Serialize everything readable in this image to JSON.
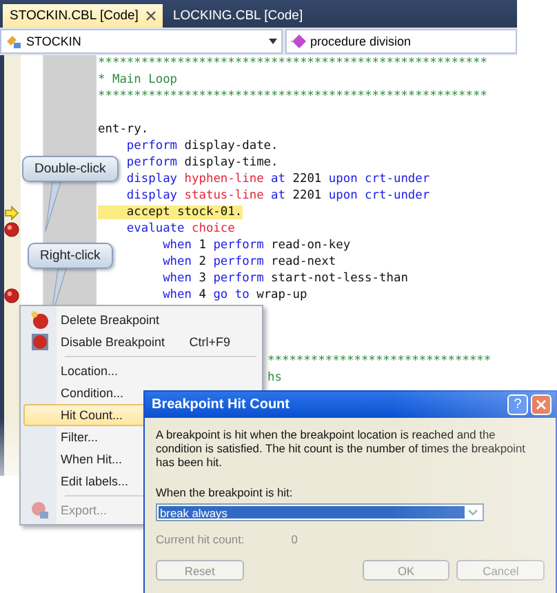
{
  "tabs": [
    {
      "label": "STOCKIN.CBL [Code]",
      "selected": true
    },
    {
      "label": "LOCKING.CBL [Code]",
      "selected": false
    }
  ],
  "nav": {
    "type_combo": "STOCKIN",
    "member_combo": "procedure division"
  },
  "code_lines": [
    {
      "tokens": [
        {
          "text": "******************************************************",
          "kind": "comment"
        }
      ],
      "current": false,
      "breakpoint": false
    },
    {
      "tokens": [
        {
          "text": "* Main Loop",
          "kind": "comment"
        }
      ],
      "current": false,
      "breakpoint": false
    },
    {
      "tokens": [
        {
          "text": "******************************************************",
          "kind": "comment"
        }
      ],
      "current": false,
      "breakpoint": false
    },
    {
      "current": false,
      "breakpoint": false
    },
    {
      "tokens": [
        {
          "text": "ent-ry.",
          "kind": "plain"
        }
      ],
      "current": false,
      "breakpoint": false
    },
    {
      "tokens": [
        {
          "text": "    perform",
          "kind": "keyword"
        },
        {
          "text": " display-date.",
          "kind": "plain"
        }
      ],
      "current": false,
      "breakpoint": false
    },
    {
      "tokens": [
        {
          "text": "    perform",
          "kind": "keyword"
        },
        {
          "text": " display-time.",
          "kind": "plain"
        }
      ],
      "current": false,
      "breakpoint": false
    },
    {
      "tokens": [
        {
          "text": "    display",
          "kind": "keyword"
        },
        {
          "text": " hyphen-line",
          "kind": "variable"
        },
        {
          "text": " at",
          "kind": "keyword"
        },
        {
          "text": " 2201",
          "kind": "plain"
        },
        {
          "text": " upon crt-under",
          "kind": "keyword"
        }
      ],
      "current": false,
      "breakpoint": false
    },
    {
      "tokens": [
        {
          "text": "    display",
          "kind": "keyword"
        },
        {
          "text": " status-line",
          "kind": "variable"
        },
        {
          "text": " at",
          "kind": "keyword"
        },
        {
          "text": " 2201",
          "kind": "plain"
        },
        {
          "text": " upon crt-under",
          "kind": "keyword"
        }
      ],
      "current": false,
      "breakpoint": false
    },
    {
      "tokens": [
        {
          "text": "    accept stock-01.",
          "kind": "plain"
        }
      ],
      "current": true,
      "breakpoint": false
    },
    {
      "tokens": [
        {
          "text": "    evaluate",
          "kind": "keyword"
        },
        {
          "text": " choice",
          "kind": "variable"
        }
      ],
      "current": false,
      "breakpoint": true
    },
    {
      "tokens": [
        {
          "text": "         when",
          "kind": "keyword"
        },
        {
          "text": " 1",
          "kind": "plain"
        },
        {
          "text": " perform",
          "kind": "keyword"
        },
        {
          "text": " read-on-key",
          "kind": "plain"
        }
      ],
      "current": false,
      "breakpoint": false
    },
    {
      "tokens": [
        {
          "text": "         when",
          "kind": "keyword"
        },
        {
          "text": " 2",
          "kind": "plain"
        },
        {
          "text": " perform",
          "kind": "keyword"
        },
        {
          "text": " read-next",
          "kind": "plain"
        }
      ],
      "current": false,
      "breakpoint": false
    },
    {
      "tokens": [
        {
          "text": "         when",
          "kind": "keyword"
        },
        {
          "text": " 3",
          "kind": "plain"
        },
        {
          "text": " perform",
          "kind": "keyword"
        },
        {
          "text": " start-not-less-than",
          "kind": "plain"
        }
      ],
      "current": false,
      "breakpoint": false
    },
    {
      "tokens": [
        {
          "text": "         when",
          "kind": "keyword"
        },
        {
          "text": " 4",
          "kind": "plain"
        },
        {
          "text": " go to",
          "kind": "keyword"
        },
        {
          "text": " wrap-up",
          "kind": "plain"
        }
      ],
      "current": false,
      "breakpoint": true
    }
  ],
  "code_lines_beside_menu": [
    {
      "tokens": [
        {
          "text": "*******************************",
          "kind": "comment"
        }
      ]
    },
    {
      "tokens": [
        {
          "text": "hs",
          "kind": "comment"
        }
      ]
    }
  ],
  "callouts": [
    {
      "text": "Double-click"
    },
    {
      "text": "Right-click"
    }
  ],
  "context_menu": {
    "items": [
      {
        "kind": "delete",
        "label": "Delete Breakpoint",
        "selected": false,
        "disabled": false
      },
      {
        "kind": "disable",
        "label": "Disable Breakpoint",
        "shortcut": "Ctrl+F9",
        "selected": false,
        "disabled": false
      },
      {
        "kind": "separator"
      },
      {
        "kind": "plain",
        "label": "Location...",
        "selected": false,
        "disabled": false
      },
      {
        "kind": "plain",
        "label": "Condition...",
        "selected": false,
        "disabled": false
      },
      {
        "kind": "plain",
        "label": "Hit Count...",
        "selected": true,
        "disabled": false
      },
      {
        "kind": "plain",
        "label": "Filter...",
        "selected": false,
        "disabled": false
      },
      {
        "kind": "plain",
        "label": "When Hit...",
        "selected": false,
        "disabled": false
      },
      {
        "kind": "plain",
        "label": "Edit labels...",
        "selected": false,
        "disabled": false
      },
      {
        "kind": "separator"
      },
      {
        "kind": "export",
        "label": "Export...",
        "selected": false,
        "disabled": true
      }
    ]
  },
  "dialog": {
    "title": "Breakpoint Hit Count",
    "help": "?",
    "description": "A breakpoint is hit when the breakpoint location is reached and the condition is satisfied. The hit count is the number of times the breakpoint has been hit.",
    "prompt": "When the breakpoint is hit:",
    "condition": "break always",
    "hit_count_label": "Current hit count:",
    "hit_count": "0",
    "buttons": [
      {
        "label": "Reset",
        "disabled": true
      },
      {
        "label": "OK",
        "disabled": true
      },
      {
        "label": "Cancel",
        "disabled": true
      }
    ]
  }
}
